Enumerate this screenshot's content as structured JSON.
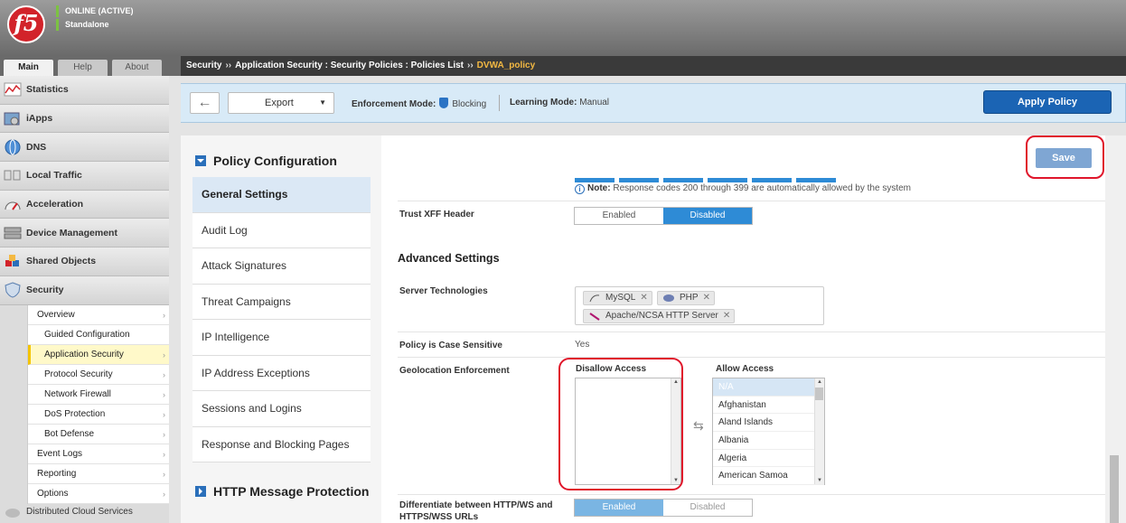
{
  "header": {
    "logo_text": "f5",
    "status_line1": "ONLINE (ACTIVE)",
    "status_line2": "Standalone"
  },
  "tabs": [
    "Main",
    "Help",
    "About"
  ],
  "breadcrumb": {
    "root": "Security",
    "sep": "››",
    "path": "Application Security : Security Policies : Policies List",
    "current": "DVWA_policy"
  },
  "sidebar": {
    "items": [
      {
        "label": "Statistics",
        "icon": "chart-icon"
      },
      {
        "label": "iApps",
        "icon": "gear-icon"
      },
      {
        "label": "DNS",
        "icon": "globe-icon"
      },
      {
        "label": "Local Traffic",
        "icon": "traffic-icon"
      },
      {
        "label": "Acceleration",
        "icon": "gauge-icon"
      },
      {
        "label": "Device Management",
        "icon": "server-icon"
      },
      {
        "label": "Shared Objects",
        "icon": "cubes-icon"
      },
      {
        "label": "Security",
        "icon": "shield-icon"
      }
    ],
    "security_sub": [
      "Overview",
      "Guided Configuration",
      "Application Security",
      "Protocol Security",
      "Network Firewall",
      "DoS Protection",
      "Bot Defense",
      "Event Logs",
      "Reporting",
      "Options"
    ],
    "bottom_item": "Distributed Cloud Services"
  },
  "toolbar": {
    "back_icon": "←",
    "export_label": "Export",
    "enforcement_label": "Enforcement Mode:",
    "enforcement_value": "Blocking",
    "learning_label": "Learning Mode:",
    "learning_value": "Manual",
    "apply_label": "Apply Policy"
  },
  "policy_menu": {
    "heading": "Policy Configuration",
    "items": [
      "General Settings",
      "Audit Log",
      "Attack Signatures",
      "Threat Campaigns",
      "IP Intelligence",
      "IP Address Exceptions",
      "Sessions and Logins",
      "Response and Blocking Pages"
    ],
    "footer_heading": "HTTP Message Protection"
  },
  "panel": {
    "save_label": "Save",
    "note_bold": "Note:",
    "note_text": "Response codes 200 through 399 are automatically allowed by the system",
    "trust_xff": {
      "label": "Trust XFF Header",
      "enabled": "Enabled",
      "disabled": "Disabled"
    },
    "advanced_heading": "Advanced Settings",
    "server_tech": {
      "label": "Server Technologies",
      "tags": [
        "MySQL",
        "PHP",
        "Apache/NCSA HTTP Server"
      ]
    },
    "case_sensitive": {
      "label": "Policy is Case Sensitive",
      "value": "Yes"
    },
    "geo": {
      "label": "Geolocation Enforcement",
      "disallow_label": "Disallow Access",
      "allow_label": "Allow Access",
      "allow_items": [
        "N/A",
        "Afghanistan",
        "Aland Islands",
        "Albania",
        "Algeria",
        "American Samoa"
      ]
    },
    "differentiate": {
      "label": "Differentiate between HTTP/WS and HTTPS/WSS URLs",
      "enabled": "Enabled",
      "disabled": "Disabled"
    }
  }
}
